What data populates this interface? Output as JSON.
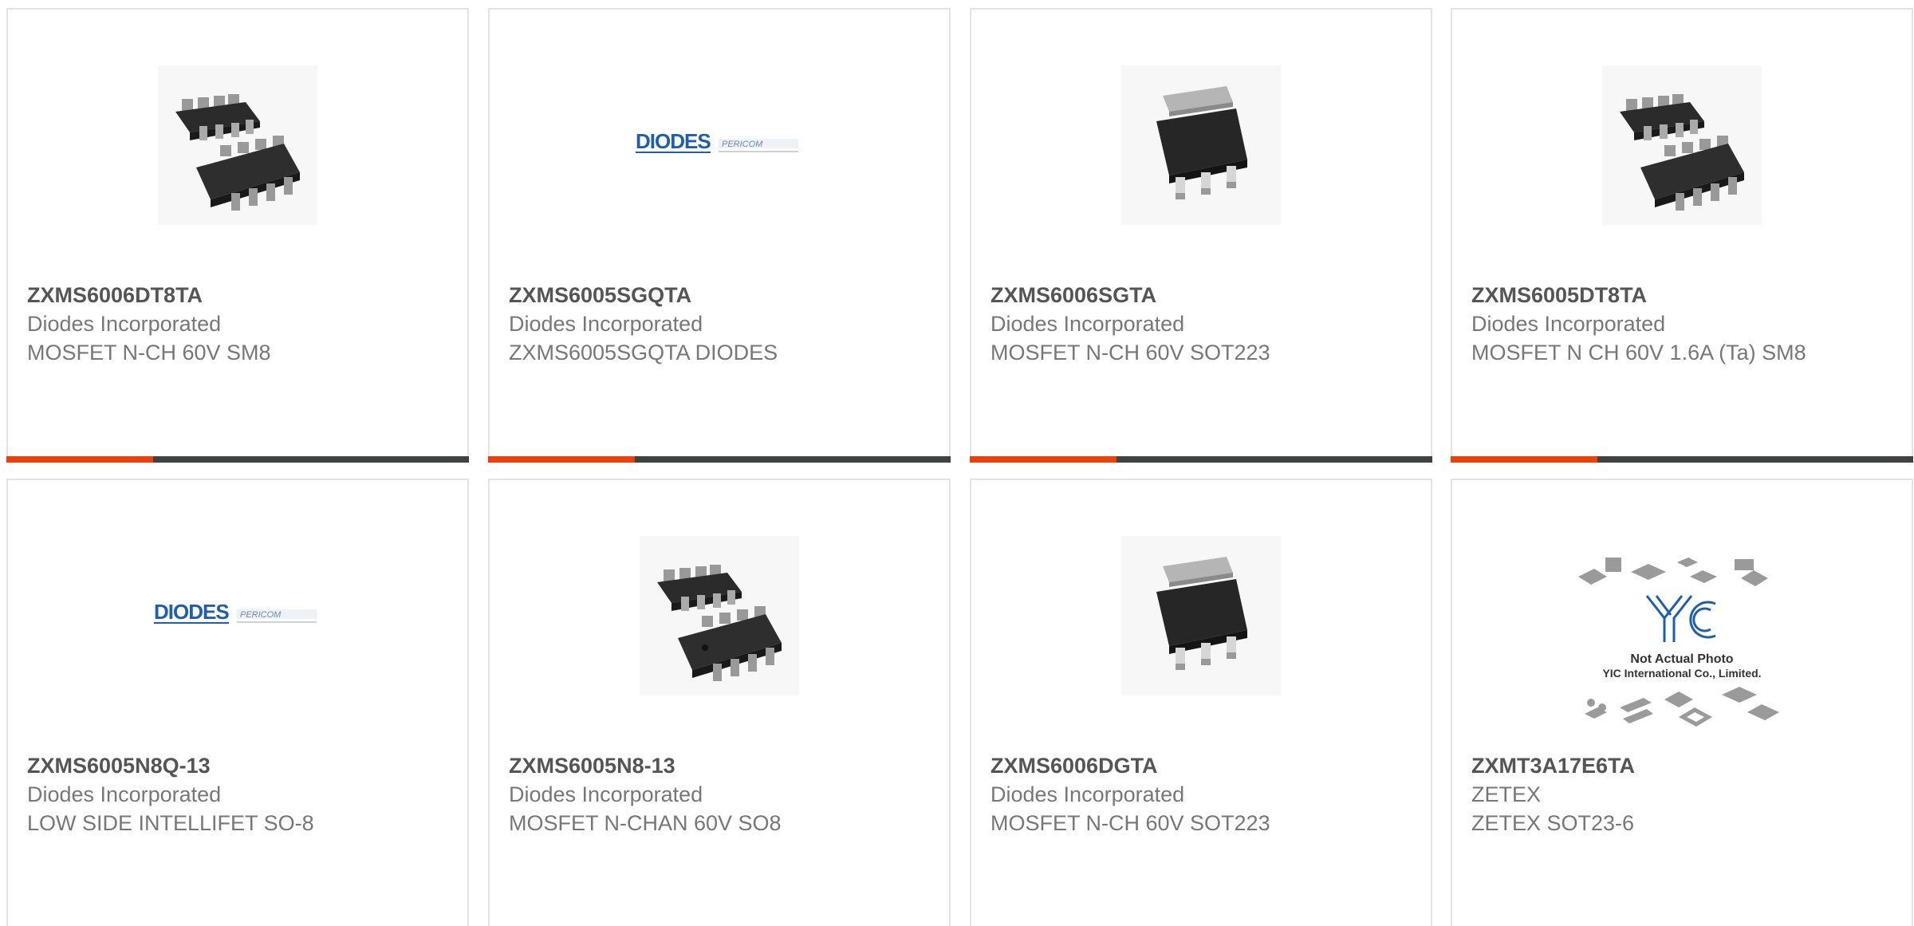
{
  "products": [
    {
      "part_number": "ZXMS6006DT8TA",
      "manufacturer": "Diodes Incorporated",
      "description": "MOSFET N-CH 60V SM8",
      "image": "so8-chip-pair"
    },
    {
      "part_number": "ZXMS6005SGQTA",
      "manufacturer": "Diodes Incorporated",
      "description": "ZXMS6005SGQTA DIODES",
      "image": "diodes-pericom-logo"
    },
    {
      "part_number": "ZXMS6006SGTA",
      "manufacturer": "Diodes Incorporated",
      "description": "MOSFET N-CH 60V SOT223",
      "image": "sot223-chip"
    },
    {
      "part_number": "ZXMS6005DT8TA",
      "manufacturer": "Diodes Incorporated",
      "description": "MOSFET N CH 60V 1.6A (Ta) SM8",
      "image": "so8-chip-pair"
    },
    {
      "part_number": "ZXMS6005N8Q-13",
      "manufacturer": "Diodes Incorporated",
      "description": "LOW SIDE INTELLIFET SO-8",
      "image": "diodes-pericom-logo"
    },
    {
      "part_number": "ZXMS6005N8-13",
      "manufacturer": "Diodes Incorporated",
      "description": "MOSFET N-CHAN 60V SO8",
      "image": "so8-chip-pair"
    },
    {
      "part_number": "ZXMS6006DGTA",
      "manufacturer": "Diodes Incorporated",
      "description": "MOSFET N-CH 60V SOT223",
      "image": "sot223-chip"
    },
    {
      "part_number": "ZXMT3A17E6TA",
      "manufacturer": "ZETEX",
      "description": "ZETEX SOT23-6",
      "image": "yic-placeholder"
    }
  ],
  "logos": {
    "diodes": "DIODES",
    "pericom": "PERICOM",
    "yic": "YIC",
    "not_actual_photo": "Not Actual Photo",
    "yic_company": "YIC International Co., Limited."
  },
  "colors": {
    "accent_red": "#e8410c",
    "bar_dark": "#3f4143",
    "part_number_text": "#555555",
    "secondary_text": "#777777",
    "diodes_blue": "#1f5fa8"
  }
}
